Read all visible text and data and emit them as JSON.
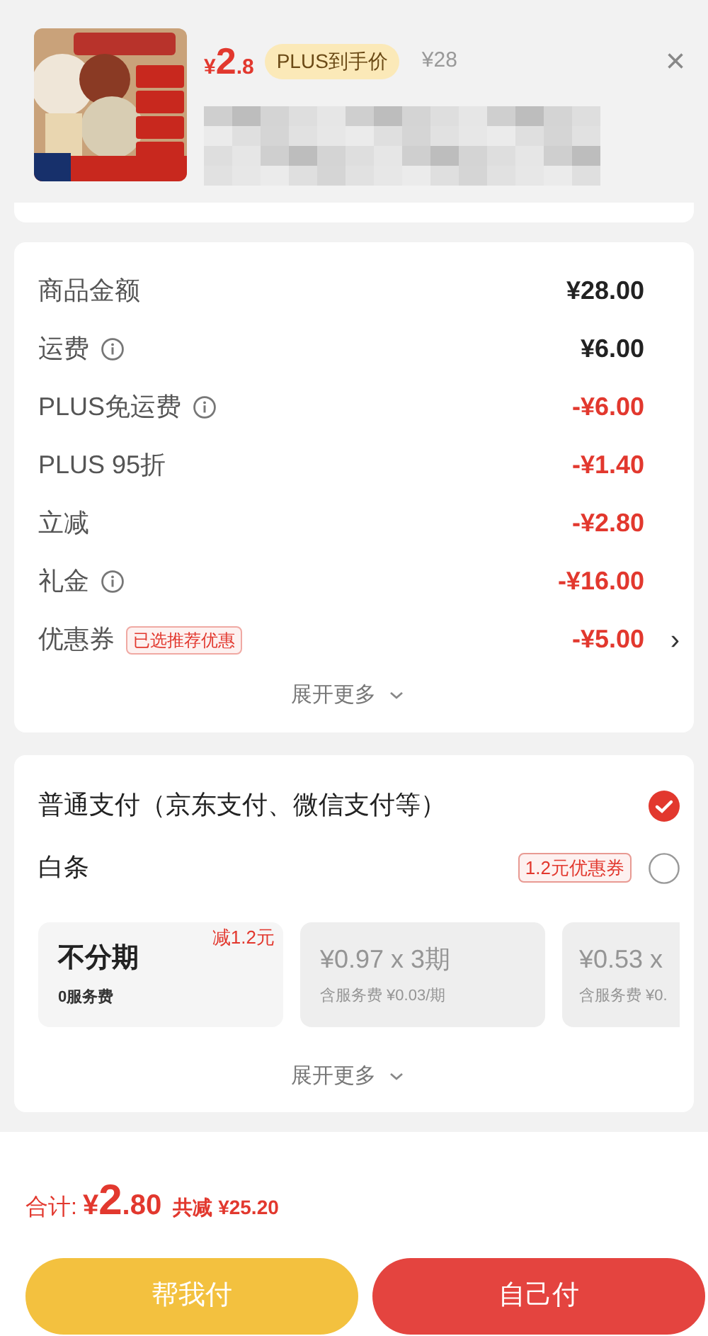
{
  "product": {
    "price": {
      "currency": "¥",
      "integer": "2",
      "decimal": ".8"
    },
    "price_badge": "PLUS到手价",
    "original_price": "¥28",
    "close": "×"
  },
  "summary": {
    "rows": [
      {
        "label": "商品金额",
        "info": false,
        "value": "¥28.00",
        "discount": false
      },
      {
        "label": "运费",
        "info": true,
        "value": "¥6.00",
        "discount": false
      },
      {
        "label": "PLUS免运费",
        "info": true,
        "value": "-¥6.00",
        "discount": true
      },
      {
        "label": "PLUS 95折",
        "info": false,
        "value": "-¥1.40",
        "discount": true
      },
      {
        "label": "立减",
        "info": false,
        "value": "-¥2.80",
        "discount": true
      },
      {
        "label": "礼金",
        "info": true,
        "value": "-¥16.00",
        "discount": true
      },
      {
        "label": "优惠券",
        "info": false,
        "tag": "已选推荐优惠",
        "value": "-¥5.00",
        "discount": true,
        "chevron": "›"
      }
    ],
    "expand": "展开更多"
  },
  "payment": {
    "methods": [
      {
        "label": "普通支付（京东支付、微信支付等）",
        "selected": true
      },
      {
        "label": "白条",
        "tag": "1.2元优惠券",
        "selected": false
      }
    ],
    "plans": [
      {
        "title": "不分期",
        "subtitle": "0服务费",
        "badge": "减1.2元",
        "selected": true
      },
      {
        "title": "¥0.97 x 3期",
        "subtitle": "含服务费 ¥0.03/期",
        "selected": false
      },
      {
        "title": "¥0.53 x",
        "subtitle": "含服务费 ¥0.",
        "selected": false
      }
    ],
    "expand": "展开更多"
  },
  "footer": {
    "total_label": "合计:",
    "total": {
      "currency": "¥",
      "integer": "2",
      "decimal": ".80"
    },
    "saved_label": "共减",
    "saved": "¥25.20",
    "buttons": [
      {
        "label": "帮我付",
        "kind": "secondary"
      },
      {
        "label": "自己付",
        "kind": "primary"
      }
    ]
  }
}
